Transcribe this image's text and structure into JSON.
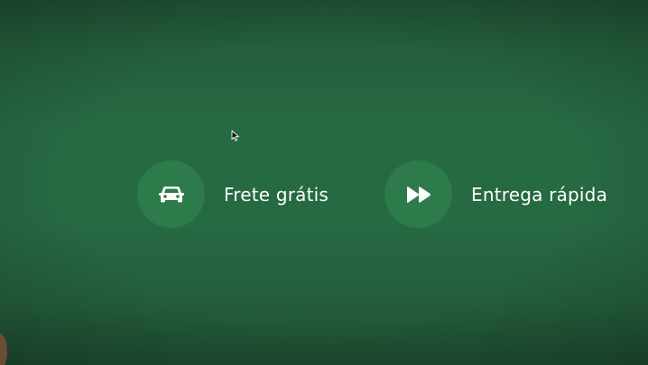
{
  "features": [
    {
      "label": "Frete grátis",
      "icon": "car-icon"
    },
    {
      "label": "Entrega rápida",
      "icon": "fast-forward-icon"
    }
  ],
  "colors": {
    "background": "#266a42",
    "icon_circle": "#2d7a4b",
    "text": "#ffffff"
  },
  "cursor": {
    "icon": "mouse-pointer-icon"
  }
}
